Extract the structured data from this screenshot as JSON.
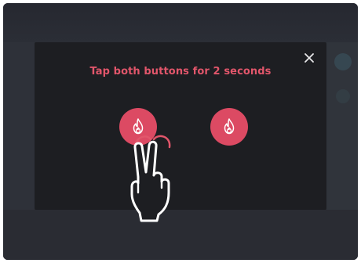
{
  "modal": {
    "title": "Tap both buttons for 2 seconds",
    "close_icon": "close-icon",
    "buttons": [
      {
        "icon": "fire-icon"
      },
      {
        "icon": "fire-icon"
      }
    ],
    "gesture_icon": "two-finger-tap-icon"
  },
  "colors": {
    "accent": "#e2566b",
    "button": "#dc4a63",
    "modal_bg": "#1d1e22",
    "backdrop": "#2b2d34"
  }
}
